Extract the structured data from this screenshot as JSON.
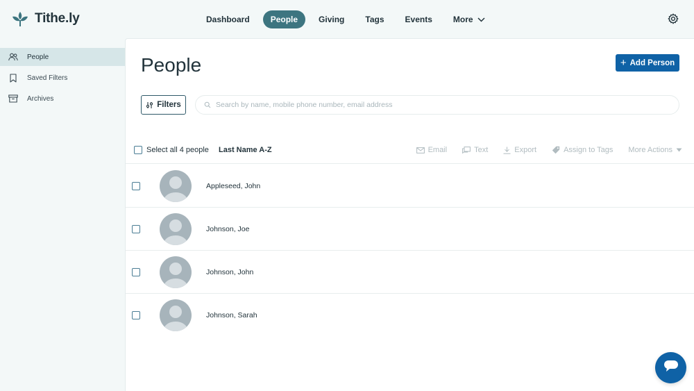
{
  "brand": {
    "name": "Tithe.ly",
    "color": "#3d7580",
    "icon": "sprout-logo-icon"
  },
  "nav": {
    "items": [
      {
        "label": "Dashboard",
        "active": false
      },
      {
        "label": "People",
        "active": true
      },
      {
        "label": "Giving",
        "active": false
      },
      {
        "label": "Tags",
        "active": false
      },
      {
        "label": "Events",
        "active": false
      },
      {
        "label": "More",
        "active": false,
        "icon": "chevron-down-icon"
      }
    ],
    "settings_icon": "gear-icon"
  },
  "sidebar": {
    "items": [
      {
        "label": "People",
        "icon": "users-icon",
        "active": true
      },
      {
        "label": "Saved Filters",
        "icon": "bookmark-icon",
        "active": false
      },
      {
        "label": "Archives",
        "icon": "archive-box-icon",
        "active": false
      }
    ]
  },
  "main": {
    "title": "People",
    "add_button": "Add Person",
    "filters_button": "Filters",
    "search_placeholder": "Search by name, mobile phone number, email address",
    "select_all": "Select all 4 people",
    "sort": "Last Name A-Z",
    "actions": [
      {
        "label": "Email",
        "icon": "mail-icon"
      },
      {
        "label": "Text",
        "icon": "message-icon"
      },
      {
        "label": "Export",
        "icon": "download-icon"
      },
      {
        "label": "Assign to Tags",
        "icon": "tag-icon"
      },
      {
        "label": "More Actions",
        "icon": "caret-down-icon"
      }
    ],
    "people": [
      {
        "name": "Appleseed, John"
      },
      {
        "name": "Johnson, Joe"
      },
      {
        "name": "Johnson, John"
      },
      {
        "name": "Johnson, Sarah"
      }
    ]
  },
  "colors": {
    "accent": "#3d7580",
    "primary_button": "#0f62a6",
    "sidebar_active": "#d6e6e8"
  }
}
